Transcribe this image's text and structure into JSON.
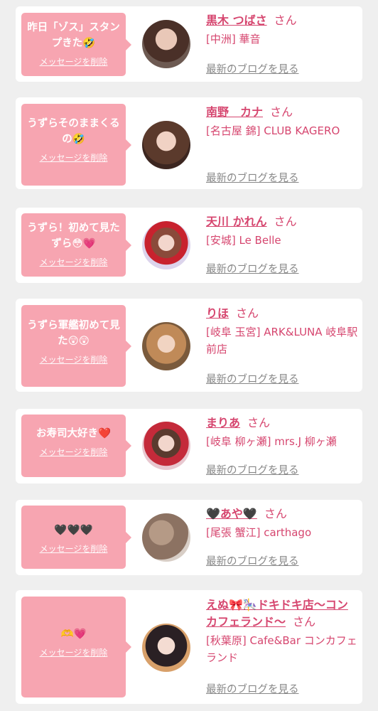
{
  "delete_label": "メッセージを削除",
  "blog_label": "最新のブログを見る",
  "san_label": "さん",
  "entries": [
    {
      "message": "昨日「ゾス」スタンプきた🤣",
      "name": "黒木 つばさ",
      "shop": "[中洲] 華音"
    },
    {
      "message": "うずらそのままくるの🤣",
      "name": "南野　カナ",
      "shop": "[名古屋 錦] CLUB KAGERO"
    },
    {
      "message": "うずら！初めて見たずら😳💗",
      "name": "天川 かれん",
      "shop": "[安城] Le Belle"
    },
    {
      "message": "うずら軍艦初めて見た😲😲",
      "name": "りほ",
      "shop": "[岐阜 玉宮] ARK&LUNA 岐阜駅前店"
    },
    {
      "message": "お寿司大好き❤️",
      "name": "まりあ",
      "shop": "[岐阜 柳ヶ瀬] mrs.J 柳ヶ瀬"
    },
    {
      "message": "🖤🖤🖤",
      "name": "🖤あや🖤",
      "shop": "[尾張 蟹江] carthago"
    },
    {
      "message": "🫶💗",
      "name": "えぬ🎀🎠ドキドキ店〜コンカフェランド〜",
      "shop": "[秋葉原] Cafe&Bar コンカフェランド"
    }
  ],
  "colors": {
    "background": "#efefef",
    "bubble": "#f7a5b1",
    "name": "#d6466f",
    "blog_link": "#888888"
  }
}
